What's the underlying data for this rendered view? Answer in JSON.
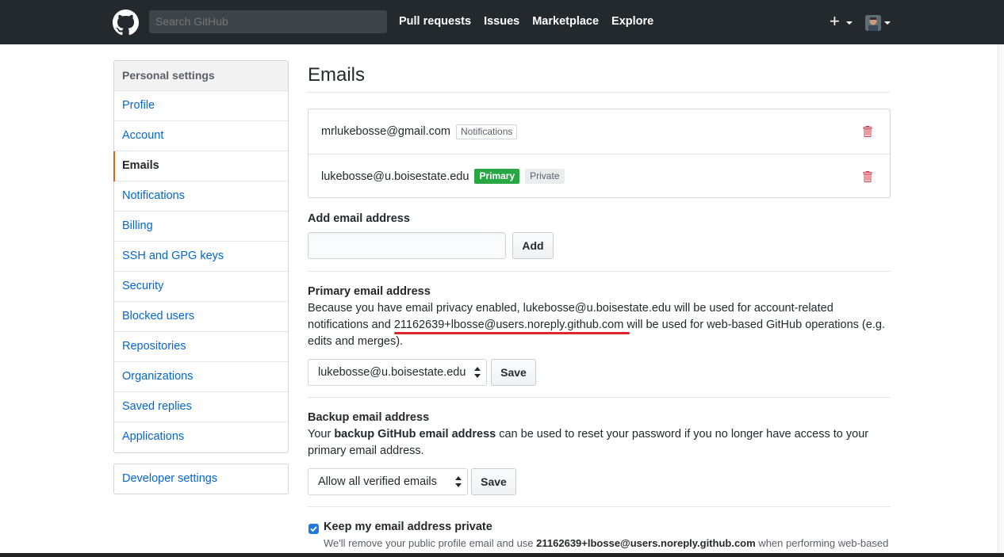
{
  "header": {
    "search_placeholder": "Search GitHub",
    "nav": [
      "Pull requests",
      "Issues",
      "Marketplace",
      "Explore"
    ],
    "plus": "+"
  },
  "sidebar": {
    "heading": "Personal settings",
    "items": [
      "Profile",
      "Account",
      "Emails",
      "Notifications",
      "Billing",
      "SSH and GPG keys",
      "Security",
      "Blocked users",
      "Repositories",
      "Organizations",
      "Saved replies",
      "Applications"
    ],
    "active": "Emails",
    "developer": "Developer settings"
  },
  "main": {
    "title": "Emails",
    "emails": [
      {
        "address": "mrlukebosse@gmail.com",
        "tags": [
          "Notifications"
        ]
      },
      {
        "address": "lukebosse@u.boisestate.edu",
        "primary": "Primary",
        "private": "Private"
      }
    ],
    "add": {
      "label": "Add email address",
      "value": "",
      "button": "Add"
    },
    "primary": {
      "label": "Primary email address",
      "line1": "Because you have email privacy enabled, lukebosse@u.boisestate.edu will be used for account-related",
      "line2_pre": "notifications and ",
      "line2_link": "21162639+lbosse@users.noreply.github.com",
      "line2_post": " will be used for web-based GitHub operations (e.g.",
      "line3": "edits and merges).",
      "select_value": "lukebosse@u.boisestate.edu",
      "button": "Save"
    },
    "backup": {
      "label": "Backup email address",
      "pre": "Your ",
      "bold": "backup GitHub email address",
      "post": " can be used to reset your password if you no longer have access to your",
      "line2": "primary email address.",
      "select_value": "Allow all verified emails",
      "button": "Save"
    },
    "keep_private": {
      "checked": true,
      "label": "Keep my email address private",
      "desc_pre": "We'll remove your public profile email and use ",
      "desc_bold": "21162639+lbosse@users.noreply.github.com",
      "desc_post": " when performing web-based Git"
    }
  },
  "colors": {
    "header": "#24292e",
    "link": "#0366d6",
    "primary_tag": "#28a745",
    "active_border": "#e36209",
    "annotation": "#e0262b"
  }
}
